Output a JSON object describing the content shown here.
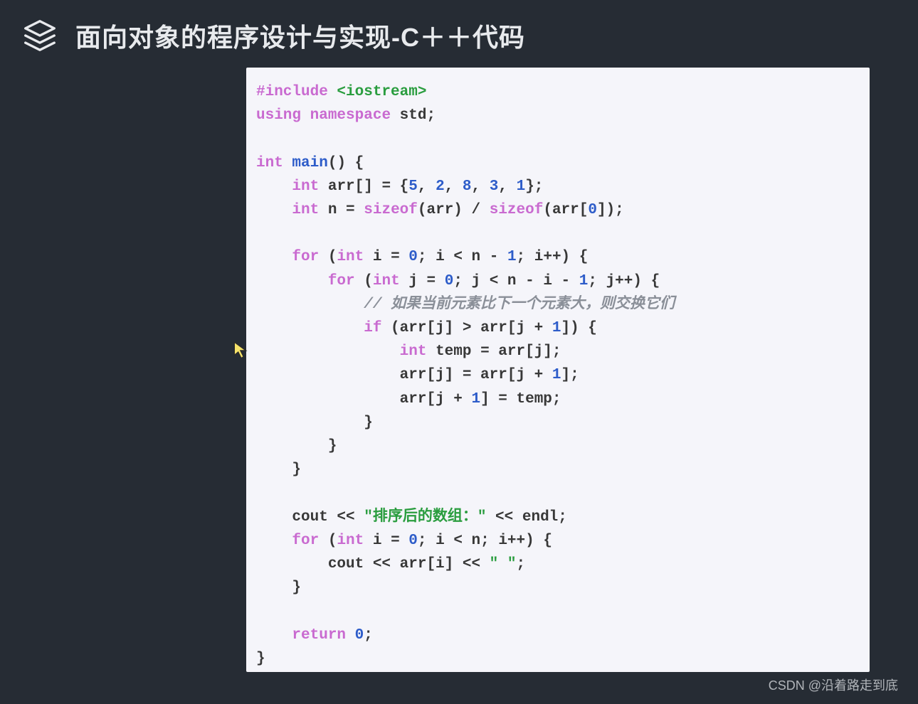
{
  "header": {
    "title": "面向对象的程序设计与实现-C＋＋代码"
  },
  "code": {
    "lines": [
      [
        {
          "t": "#include ",
          "c": "tok-directive"
        },
        {
          "t": "<iostream>",
          "c": "tok-include-target"
        }
      ],
      [
        {
          "t": "using ",
          "c": "tok-keyword"
        },
        {
          "t": "namespace ",
          "c": "tok-keyword"
        },
        {
          "t": "std",
          "c": "tok-name"
        },
        {
          "t": ";",
          "c": "tok-punct"
        }
      ],
      [],
      [
        {
          "t": "int ",
          "c": "tok-type"
        },
        {
          "t": "main",
          "c": "tok-func"
        },
        {
          "t": "() {",
          "c": "tok-punct"
        }
      ],
      [
        {
          "t": "    ",
          "c": "tok-punct"
        },
        {
          "t": "int ",
          "c": "tok-type"
        },
        {
          "t": "arr[] = {",
          "c": "tok-name"
        },
        {
          "t": "5",
          "c": "tok-num"
        },
        {
          "t": ", ",
          "c": "tok-punct"
        },
        {
          "t": "2",
          "c": "tok-num"
        },
        {
          "t": ", ",
          "c": "tok-punct"
        },
        {
          "t": "8",
          "c": "tok-num"
        },
        {
          "t": ", ",
          "c": "tok-punct"
        },
        {
          "t": "3",
          "c": "tok-num"
        },
        {
          "t": ", ",
          "c": "tok-punct"
        },
        {
          "t": "1",
          "c": "tok-num"
        },
        {
          "t": "};",
          "c": "tok-punct"
        }
      ],
      [
        {
          "t": "    ",
          "c": "tok-punct"
        },
        {
          "t": "int ",
          "c": "tok-type"
        },
        {
          "t": "n = ",
          "c": "tok-name"
        },
        {
          "t": "sizeof",
          "c": "tok-op-kw"
        },
        {
          "t": "(arr) / ",
          "c": "tok-name"
        },
        {
          "t": "sizeof",
          "c": "tok-op-kw"
        },
        {
          "t": "(arr[",
          "c": "tok-name"
        },
        {
          "t": "0",
          "c": "tok-num"
        },
        {
          "t": "]);",
          "c": "tok-punct"
        }
      ],
      [],
      [
        {
          "t": "    ",
          "c": "tok-punct"
        },
        {
          "t": "for ",
          "c": "tok-keyword"
        },
        {
          "t": "(",
          "c": "tok-punct"
        },
        {
          "t": "int ",
          "c": "tok-type"
        },
        {
          "t": "i = ",
          "c": "tok-name"
        },
        {
          "t": "0",
          "c": "tok-num"
        },
        {
          "t": "; i < n - ",
          "c": "tok-name"
        },
        {
          "t": "1",
          "c": "tok-num"
        },
        {
          "t": "; i++) {",
          "c": "tok-name"
        }
      ],
      [
        {
          "t": "        ",
          "c": "tok-punct"
        },
        {
          "t": "for ",
          "c": "tok-keyword"
        },
        {
          "t": "(",
          "c": "tok-punct"
        },
        {
          "t": "int ",
          "c": "tok-type"
        },
        {
          "t": "j = ",
          "c": "tok-name"
        },
        {
          "t": "0",
          "c": "tok-num"
        },
        {
          "t": "; j < n - i - ",
          "c": "tok-name"
        },
        {
          "t": "1",
          "c": "tok-num"
        },
        {
          "t": "; j++) {",
          "c": "tok-name"
        }
      ],
      [
        {
          "t": "            ",
          "c": "tok-punct"
        },
        {
          "t": "// 如果当前元素比下一个元素大，则交换它们",
          "c": "tok-comment"
        }
      ],
      [
        {
          "t": "            ",
          "c": "tok-punct"
        },
        {
          "t": "if ",
          "c": "tok-keyword"
        },
        {
          "t": "(arr[j] > arr[j + ",
          "c": "tok-name"
        },
        {
          "t": "1",
          "c": "tok-num"
        },
        {
          "t": "]) {",
          "c": "tok-name"
        }
      ],
      [
        {
          "t": "                ",
          "c": "tok-punct"
        },
        {
          "t": "int ",
          "c": "tok-type"
        },
        {
          "t": "temp = arr[j];",
          "c": "tok-name"
        }
      ],
      [
        {
          "t": "                ",
          "c": "tok-punct"
        },
        {
          "t": "arr[j] = arr[j + ",
          "c": "tok-name"
        },
        {
          "t": "1",
          "c": "tok-num"
        },
        {
          "t": "];",
          "c": "tok-name"
        }
      ],
      [
        {
          "t": "                ",
          "c": "tok-punct"
        },
        {
          "t": "arr[j + ",
          "c": "tok-name"
        },
        {
          "t": "1",
          "c": "tok-num"
        },
        {
          "t": "] = temp;",
          "c": "tok-name"
        }
      ],
      [
        {
          "t": "            }",
          "c": "tok-punct"
        }
      ],
      [
        {
          "t": "        }",
          "c": "tok-punct"
        }
      ],
      [
        {
          "t": "    }",
          "c": "tok-punct"
        }
      ],
      [],
      [
        {
          "t": "    cout << ",
          "c": "tok-name"
        },
        {
          "t": "\"排序后的数组：\"",
          "c": "tok-string"
        },
        {
          "t": " << endl;",
          "c": "tok-name"
        }
      ],
      [
        {
          "t": "    ",
          "c": "tok-punct"
        },
        {
          "t": "for ",
          "c": "tok-keyword"
        },
        {
          "t": "(",
          "c": "tok-punct"
        },
        {
          "t": "int ",
          "c": "tok-type"
        },
        {
          "t": "i = ",
          "c": "tok-name"
        },
        {
          "t": "0",
          "c": "tok-num"
        },
        {
          "t": "; i < n; i++) {",
          "c": "tok-name"
        }
      ],
      [
        {
          "t": "        cout << arr[i] << ",
          "c": "tok-name"
        },
        {
          "t": "\" \"",
          "c": "tok-string"
        },
        {
          "t": ";",
          "c": "tok-punct"
        }
      ],
      [
        {
          "t": "    }",
          "c": "tok-punct"
        }
      ],
      [],
      [
        {
          "t": "    ",
          "c": "tok-punct"
        },
        {
          "t": "return ",
          "c": "tok-keyword"
        },
        {
          "t": "0",
          "c": "tok-num"
        },
        {
          "t": ";",
          "c": "tok-punct"
        }
      ],
      [
        {
          "t": "}",
          "c": "tok-punct"
        }
      ]
    ]
  },
  "watermark": "CSDN @沿着路走到底"
}
